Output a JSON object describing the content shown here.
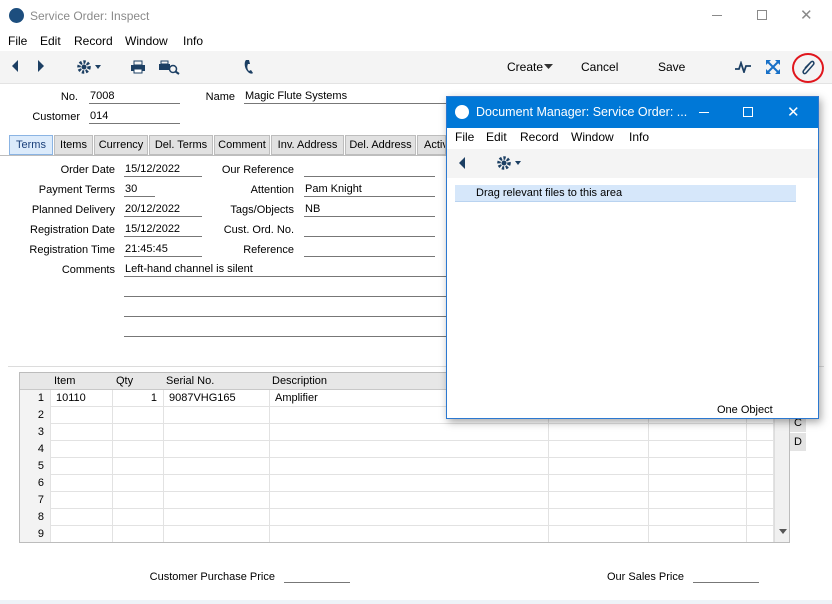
{
  "main_window": {
    "title": "Service Order: Inspect",
    "menu": [
      "File",
      "Edit",
      "Record",
      "Window",
      "Info"
    ],
    "toolbar": {
      "create": "Create",
      "cancel": "Cancel",
      "save": "Save"
    }
  },
  "header": {
    "no_label": "No.",
    "no_value": "7008",
    "name_label": "Name",
    "name_value": "Magic Flute Systems",
    "customer_label": "Customer",
    "customer_value": "014"
  },
  "tabs": [
    "Terms",
    "Items",
    "Currency",
    "Del. Terms",
    "Comment",
    "Inv. Address",
    "Del. Address",
    "Activ"
  ],
  "terms": {
    "order_date_label": "Order Date",
    "order_date": "15/12/2022",
    "payment_terms_label": "Payment Terms",
    "payment_terms": "30",
    "planned_delivery_label": "Planned Delivery",
    "planned_delivery": "20/12/2022",
    "registration_date_label": "Registration Date",
    "registration_date": "15/12/2022",
    "registration_time_label": "Registration Time",
    "registration_time": "21:45:45",
    "comments_label": "Comments",
    "comments": "Left-hand channel is silent",
    "our_reference_label": "Our Reference",
    "our_reference": "",
    "attention_label": "Attention",
    "attention": "Pam Knight",
    "tags_label": "Tags/Objects",
    "tags": "NB",
    "cust_ord_label": "Cust. Ord. No.",
    "cust_ord": "",
    "reference_label": "Reference",
    "reference": ""
  },
  "grid": {
    "headers": [
      "Item",
      "Qty",
      "Serial No.",
      "Description"
    ],
    "rows": [
      {
        "n": "1",
        "item": "10110",
        "qty": "1",
        "serial": "9087VHG165",
        "desc": "Amplifier"
      },
      {
        "n": "2",
        "item": "",
        "qty": "",
        "serial": "",
        "desc": ""
      },
      {
        "n": "3",
        "item": "",
        "qty": "",
        "serial": "",
        "desc": ""
      },
      {
        "n": "4",
        "item": "",
        "qty": "",
        "serial": "",
        "desc": ""
      },
      {
        "n": "5",
        "item": "",
        "qty": "",
        "serial": "",
        "desc": ""
      },
      {
        "n": "6",
        "item": "",
        "qty": "",
        "serial": "",
        "desc": ""
      },
      {
        "n": "7",
        "item": "",
        "qty": "",
        "serial": "",
        "desc": ""
      },
      {
        "n": "8",
        "item": "",
        "qty": "",
        "serial": "",
        "desc": ""
      },
      {
        "n": "9",
        "item": "",
        "qty": "",
        "serial": "",
        "desc": ""
      }
    ],
    "side_letters": [
      "C",
      "D"
    ]
  },
  "footer": {
    "customer_purchase_price_label": "Customer Purchase Price",
    "our_sales_price_label": "Our Sales Price"
  },
  "doc_manager": {
    "title": "Document Manager: Service Order: ...",
    "menu": [
      "File",
      "Edit",
      "Record",
      "Window",
      "Info"
    ],
    "drop_hint": "Drag relevant files to this area",
    "status": "One Object"
  },
  "colors": {
    "accent": "#0078d7",
    "attach_highlight": "#e0161d"
  }
}
